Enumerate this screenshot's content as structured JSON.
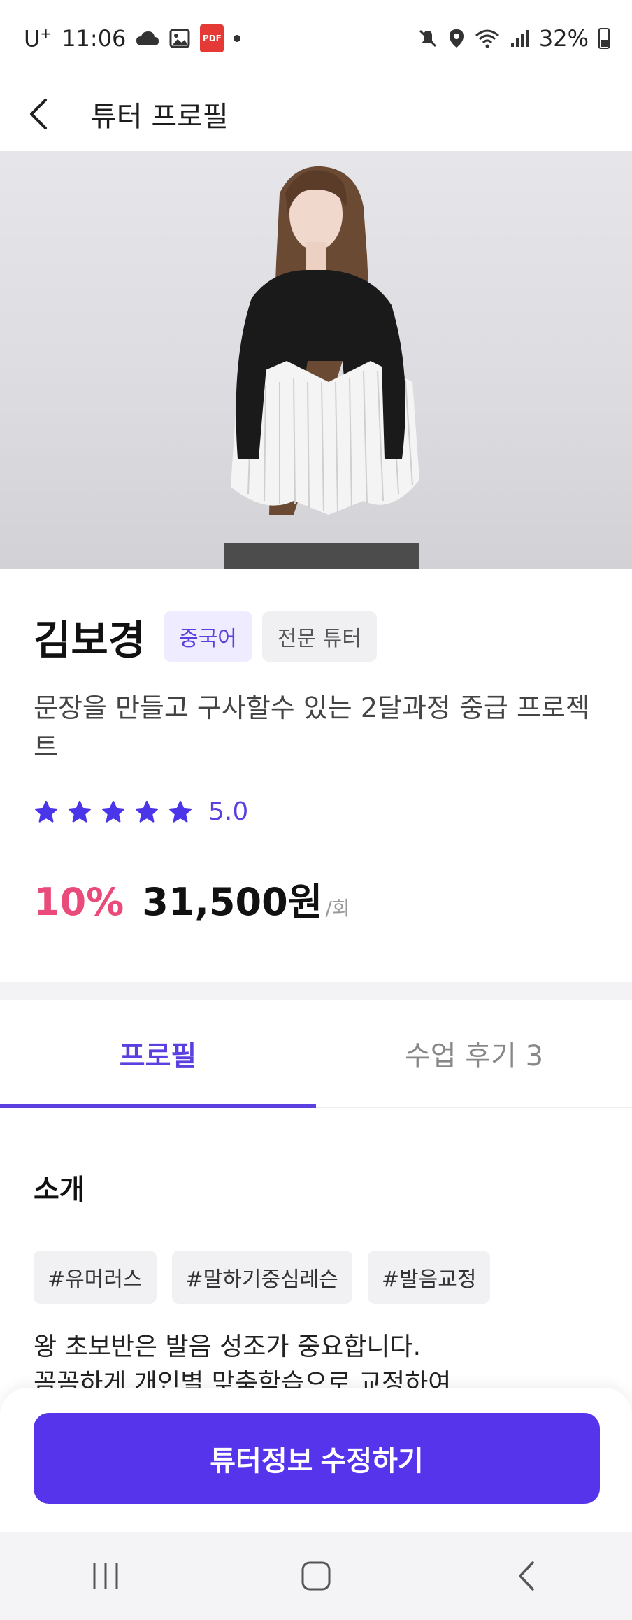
{
  "status_bar": {
    "carrier": "U",
    "carrier_sup": "+",
    "time": "11:06",
    "battery": "32%",
    "icons": [
      "cloud-icon",
      "image-icon",
      "pdf-icon",
      "dot-icon",
      "mute-icon",
      "location-icon",
      "wifi-icon",
      "signal-icon",
      "battery-icon"
    ]
  },
  "header": {
    "title": "튜터 프로필",
    "back_icon": "chevron-left-icon"
  },
  "tutor": {
    "name": "김보경",
    "language_badge": "중국어",
    "type_badge": "전문 튜터",
    "description": "문장을 만들고 구사할수 있는 2달과정 중급 프로젝트",
    "rating": 5.0,
    "rating_text": "5.0",
    "star_count": 5,
    "discount": "10%",
    "price": "31,500원",
    "price_unit": "/회"
  },
  "tabs": [
    {
      "label": "프로필",
      "active": true
    },
    {
      "label": "수업 후기 3",
      "active": false
    }
  ],
  "intro": {
    "title": "소개",
    "tags": [
      "#유머러스",
      "#말하기중심레슨",
      "#발음교정"
    ],
    "text_line1": "왕 초보반은 발음 성조가 중요합니다.",
    "text_line2": "꼼꼼하게 개인별 맞춤학습으로 교정하여"
  },
  "actions": {
    "edit_button": "튜터정보 수정하기"
  },
  "colors": {
    "accent": "#5534ec",
    "discount": "#e94c7a",
    "star": "#4a35e8"
  },
  "nav": [
    "recent-apps-icon",
    "home-icon",
    "back-icon"
  ]
}
